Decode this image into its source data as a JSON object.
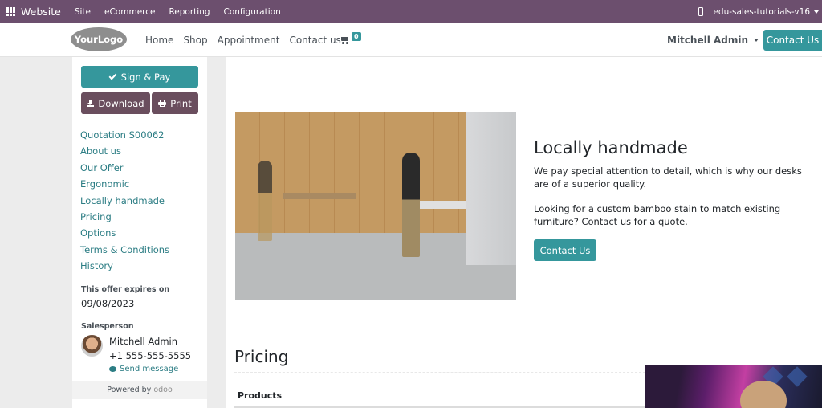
{
  "admin_bar": {
    "brand": "Website",
    "menu": [
      "Site",
      "eCommerce",
      "Reporting",
      "Configuration"
    ],
    "db_name": "edu-sales-tutorials-v16"
  },
  "header": {
    "logo_text": "YourLogo",
    "nav": [
      "Home",
      "Shop",
      "Appointment",
      "Contact us"
    ],
    "cart_count": "0",
    "user_name": "Mitchell Admin",
    "contact_button": "Contact Us"
  },
  "sidebar": {
    "sign_pay": "Sign & Pay",
    "download": "Download",
    "print": "Print",
    "toc": [
      "Quotation S00062",
      "About us",
      "Our Offer",
      "Ergonomic",
      "Locally handmade",
      "Pricing",
      "Options",
      "Terms & Conditions",
      "History"
    ],
    "expiry_label": "This offer expires on",
    "expiry_date": "09/08/2023",
    "salesperson_label": "Salesperson",
    "salesperson_name": "Mitchell Admin",
    "salesperson_phone": "+1 555-555-5555",
    "send_message": "Send message",
    "powered_by": "Powered by",
    "powered_brand": "odoo"
  },
  "main": {
    "section_title": "Locally handmade",
    "paragraph1": "We pay special attention to detail, which is why our desks are of a superior quality.",
    "paragraph2": "Looking for a custom bamboo stain to match existing furniture? Contact us for a quote.",
    "contact_button": "Contact Us",
    "pricing_title": "Pricing",
    "products_header": "Products"
  },
  "colors": {
    "admin_bar": "#6c4f6e",
    "primary": "#35979c",
    "secondary": "#6a4e5e",
    "link": "#2c7d84"
  }
}
